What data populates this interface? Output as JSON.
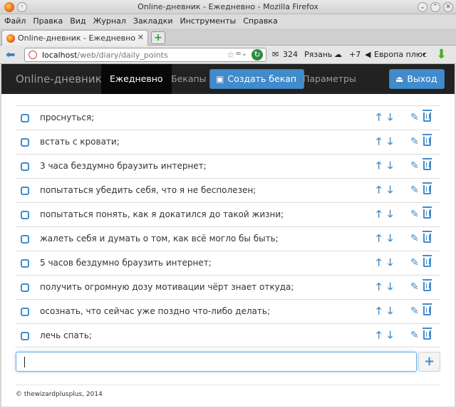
{
  "window": {
    "title": "Online-дневник - Ежедневно - Mozilla Firefox"
  },
  "menu": [
    "Файл",
    "Правка",
    "Вид",
    "Журнал",
    "Закладки",
    "Инструменты",
    "Справка"
  ],
  "tab": {
    "label": "Online-дневник - Ежедневно",
    "close": "✕"
  },
  "urlbar": {
    "host": "localhost",
    "path": "/web/diary/daily_points"
  },
  "toolbar_extras": {
    "mail_count": "324",
    "city": "Рязань",
    "temperature": "+7",
    "radio": "Европа плюс"
  },
  "app": {
    "brand": "Online-дневник",
    "nav": {
      "daily": "Ежедневно",
      "backups": "Бекапы",
      "create_backup": "Создать бекап",
      "settings": "Параметры",
      "logout": "Выход"
    },
    "items": [
      "проснуться;",
      "встать с кровати;",
      "3 часа бездумно браузить интернет;",
      "попытаться убедить себя, что я не бесполезен;",
      "попытаться понять, как я докатился до такой жизни;",
      "жалеть себя и думать о том, как всё могло бы быть;",
      "5 часов бездумно браузить интернет;",
      "получить огромную дозу мотивации чёрт знает откуда;",
      "осознать, что сейчас уже поздно что-либо делать;",
      "лечь спать;"
    ],
    "new_item_value": "",
    "footer": "© thewizardplusplus, 2014"
  },
  "colors": {
    "accent": "#428bca",
    "navbar": "#222222"
  }
}
